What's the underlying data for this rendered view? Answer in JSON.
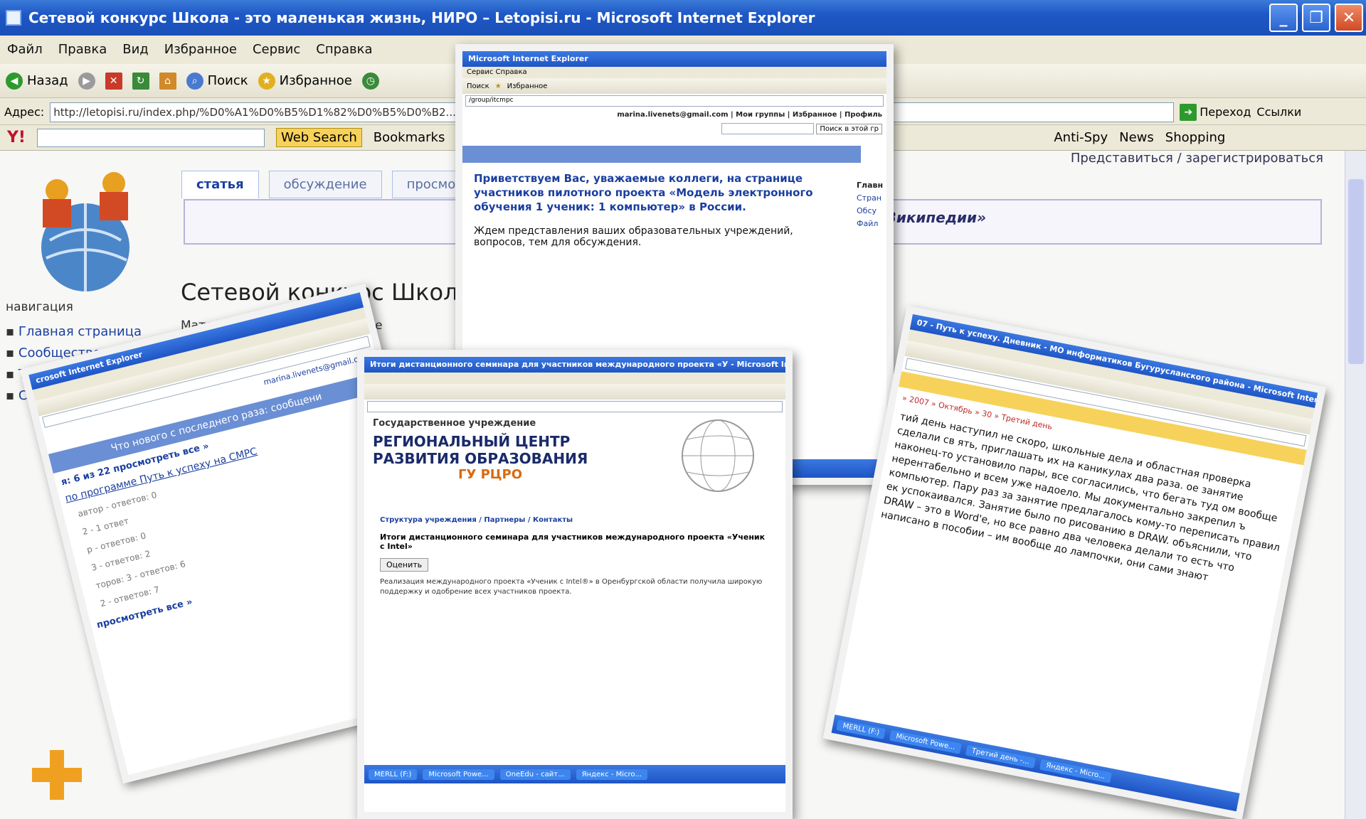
{
  "window": {
    "title": "Сетевой конкурс Школа - это маленькая жизнь, НИРО – Letopisi.ru - Microsoft Internet Explorer",
    "min": "_",
    "max": "❐",
    "close": "✕"
  },
  "menu": [
    "Файл",
    "Правка",
    "Вид",
    "Избранное",
    "Сервис",
    "Справка"
  ],
  "toolbar": {
    "back": "Назад",
    "search": "Поиск",
    "favorites": "Избранное"
  },
  "address": {
    "label": "Адрес:",
    "url": "http://letopisi.ru/index.php/%D0%A1%D0%B5%D1%82%D0%B5%D0%B2...%D0%B1%D1%81%D0%B5%D0%B0%D0%BA%D0%BE%D0%B5%D0%B5%D0%B",
    "go": "Переход",
    "links": "Ссылки"
  },
  "yahoo": {
    "web_search": "Web Search",
    "bookmarks": "Bookmarks",
    "antispy": "Anti-Spy",
    "news": "News",
    "shopping": "Shopping"
  },
  "page": {
    "login": "Представиться / зарегистрироваться",
    "tabs": [
      "статья",
      "обсуждение",
      "просмотр"
    ],
    "notice": "для Википедии»",
    "title": "Сетевой конкурс Школа - з",
    "subtitle": "Материал из Letopisi.Ru — «Вре",
    "nav_head": "навигация",
    "nav": [
      "Главная страница",
      "Сообщество",
      "Текущие события",
      "Свежие"
    ]
  },
  "card1": {
    "title": "Microsoft Internet Explorer",
    "menu": "Сервис  Справка",
    "search": "Поиск",
    "fav": "Избранное",
    "addr": "/group/itcmpc",
    "user": "marina.livenets@gmail.com | Мои группы | Избранное | Профиль",
    "search_group": "Поиск в этой гр",
    "welcome": "Приветствуем Вас, уважаемые коллеги, на странице участников пилотного проекта «Модель электронного обучения 1 ученик: 1 компьютер» в России.",
    "wait": "Ждем представления ваших образовательных учреждений, вопросов, тем для обсуждения.",
    "side": [
      "Главн",
      "Стран",
      "Обсу",
      "Файл"
    ]
  },
  "card2": {
    "title": "crosoft Internet Explorer",
    "user": "marina.livenets@gmail.com",
    "whatsnew": "Что нового с последнего раза: сообщени",
    "count": "я: 6 из 22  просмотреть все »",
    "topic": "по программе Путь к успеху на СМРС",
    "replies": [
      "автор - ответов: 0",
      "2 - 1 ответ",
      "р - ответов: 0",
      "3 - ответов: 2",
      "торов: 3 - ответов: 6",
      "2 - ответов: 7"
    ],
    "seeall": "просмотреть все »"
  },
  "card3": {
    "title": "Итоги дистанционного семинара для участников международного проекта «У - Microsoft Internet",
    "org1": "Государственное учреждение",
    "org2": "РЕГИОНАЛЬНЫЙ ЦЕНТР",
    "org3": "РАЗВИТИЯ ОБРАЗОВАНИЯ",
    "org4": "ГУ РЦРО",
    "links": "Структура учреждения / Партнеры / Контакты",
    "heading": "Итоги дистанционного семинара для участников международного проекта «Ученик с Intel»",
    "rate": "Оценить",
    "body": "Реализация международного проекта «Ученик с Intel®» в Оренбургской области получила широкую поддержку и одобрение всех участников проекта.",
    "task": [
      "MERLL (F:)",
      "Microsoft Powe...",
      "OneEdu - сайт...",
      "Яндекс - Micro..."
    ]
  },
  "card4": {
    "title": "07 - Путь к успеху. Дневник - МО информатиков Бугурусланского района - Microsoft Intern",
    "crumb": "» 2007 » Октябрь » 30 » Третий день",
    "text": "тий день наступил не скоро, школьные дела и областная проверка сделали св ять, приглашать их на каникулах два раза. ое занятие наконец-то установило пары, все согласились, что бегать туд ом вообще нерентабельно и всем уже надоело. Мы документально закрепил ъ компьютер. Пару раз за занятие предлагалось кому-то переписать правил ек успокаивался. Занятие было по рисованию в DRAW. объяснили, что DRAW – это в Word'е, но все равно два человека делали то есть что написано в пособии – им вообще до лампочки, они сами знают",
    "task": [
      "MERLL (F:)",
      "Microsoft Powe...",
      "Третий день -...",
      "Яндекс - Micro..."
    ]
  }
}
